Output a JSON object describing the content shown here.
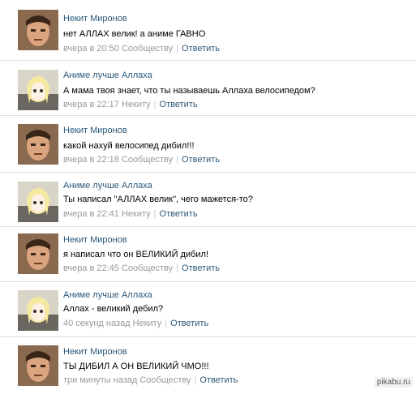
{
  "comments": [
    {
      "author": "Некит Миронов",
      "text": "нет АЛЛАХ велик! а аниме ГАВНО",
      "date": "вчера в 20:50",
      "target": "Сообществу",
      "reply": "Ответить",
      "avatar_icon": "man-avatar"
    },
    {
      "author": "Аниме лучше Аллаха",
      "text": "А мама твоя знает, что ты называешь Аллаха велосипедом?",
      "date": "вчера в 22:17",
      "target": "Некиту",
      "reply": "Ответить",
      "avatar_icon": "anime-girl-avatar"
    },
    {
      "author": "Некит Миронов",
      "text": "какой нахуй велосипед дибил!!!",
      "date": "вчера в 22:18",
      "target": "Сообществу",
      "reply": "Ответить",
      "avatar_icon": "man-avatar"
    },
    {
      "author": "Аниме лучше Аллаха",
      "text": "Ты написал \"АЛЛАХ велик\", чего мажется-то?",
      "date": "вчера в 22:41",
      "target": "Некиту",
      "reply": "Ответить",
      "avatar_icon": "anime-girl-avatar"
    },
    {
      "author": "Некит Миронов",
      "text": "я написал что он ВЕЛИКИЙ дибил!",
      "date": "вчера в 22:45",
      "target": "Сообществу",
      "reply": "Ответить",
      "avatar_icon": "man-avatar"
    },
    {
      "author": "Аниме лучше Аллаха",
      "text": "Аллах - великий дебил?",
      "date": "40 секунд назад",
      "target": "Некиту",
      "reply": "Ответить",
      "avatar_icon": "anime-girl-avatar"
    },
    {
      "author": "Некит Миронов",
      "text": "ТЫ ДИБИЛ А ОН ВЕЛИКИЙ ЧМО!!!",
      "date": "три минуты назад",
      "target": "Сообществу",
      "reply": "Ответить",
      "avatar_icon": "man-avatar"
    }
  ],
  "watermark": "pikabu.ru"
}
